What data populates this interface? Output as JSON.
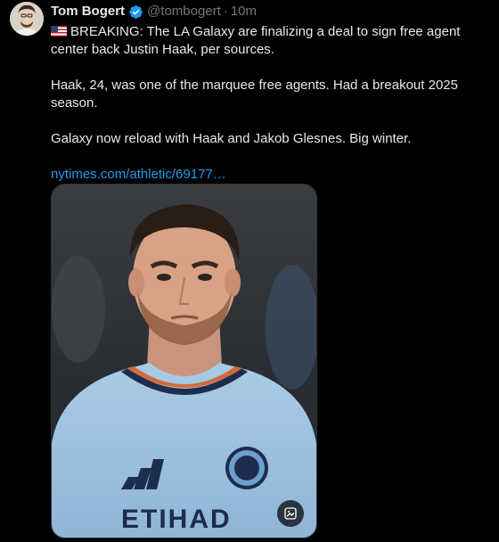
{
  "tweet": {
    "author_name": "Tom Bogert",
    "handle": "@tombogert",
    "separator": "·",
    "time": "10m",
    "paragraphs": [
      "BREAKING: The LA Galaxy are finalizing a deal to sign free agent center back Justin Haak, per sources.",
      "Haak, 24, was one of the marquee free agents. Had a breakout 2025 season.",
      "Galaxy now reload with Haak and Jakob Glesnes. Big winter."
    ],
    "link": "nytimes.com/athletic/69177…"
  },
  "media": {
    "sponsor_text": "ETIHAD"
  },
  "icons": {
    "verified": "verified-badge-icon",
    "flag": "us-flag-icon",
    "media_action": "image-edit-icon"
  },
  "colors": {
    "background": "#000000",
    "text": "#e7e9ea",
    "muted": "#71767b",
    "link": "#1d9bf0"
  }
}
